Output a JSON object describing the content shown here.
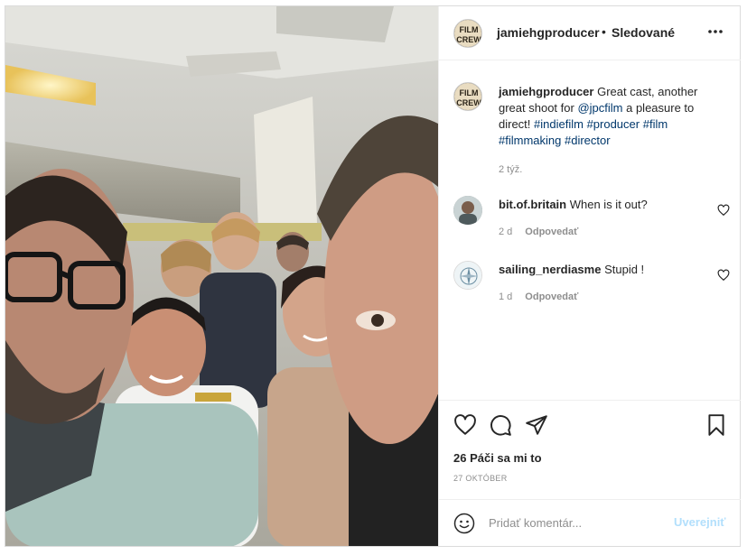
{
  "header": {
    "username": "jamiehgproducer",
    "separator": "•",
    "follow_label": "Sledované",
    "avatar_text_top": "FILM",
    "avatar_text_bottom": "CREW"
  },
  "caption": {
    "username": "jamiehgproducer",
    "text_before_mention": "Great cast, another great shoot for ",
    "mention": "@jpcfilm",
    "text_after_mention": " a pleasure to direct! ",
    "hashtags": [
      "#indiefilm",
      "#producer",
      "#film",
      "#filmmaking",
      "#director"
    ],
    "age": "2 týž."
  },
  "comments": [
    {
      "username": "bit.of.britain",
      "text": "When is it out?",
      "age": "2 d",
      "reply_label": "Odpovedať"
    },
    {
      "username": "sailing_nerdiasme",
      "text": "Stupid !",
      "age": "1 d",
      "reply_label": "Odpovedať"
    }
  ],
  "actions": {
    "likes": "26 Páči sa mi to",
    "date": "27 OKTÓBER"
  },
  "add_comment": {
    "placeholder": "Pridať komentár...",
    "post_label": "Uverejniť"
  },
  "colors": {
    "link": "#00376b",
    "muted": "#8e8e8e",
    "post_disabled": "#b2dffc",
    "text": "#262626"
  },
  "icons": [
    "more-icon",
    "heart-icon",
    "comment-icon",
    "share-icon",
    "bookmark-icon",
    "emoji-icon",
    "small-heart-icon"
  ]
}
